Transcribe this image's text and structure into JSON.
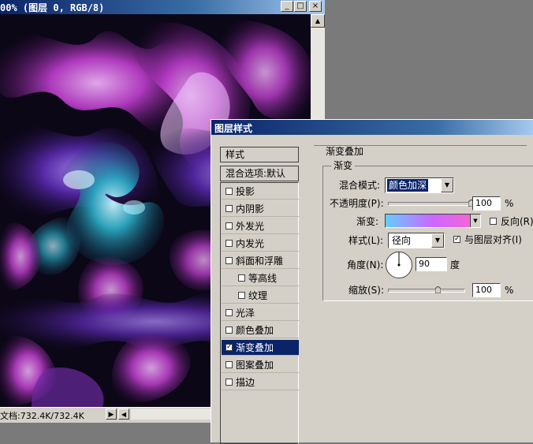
{
  "document": {
    "title": "00% (图层 0, RGB/8)",
    "buttons": {
      "minimize": "_",
      "maximize": "□",
      "close": "×"
    },
    "status_text": "文档:732.4K/732.4K"
  },
  "dialog": {
    "title": "图层样式",
    "list": {
      "header_styles": "样式",
      "header_blending": "混合选项:默认",
      "items": [
        {
          "label": "投影",
          "checked": false,
          "indent": false,
          "selected": false
        },
        {
          "label": "内阴影",
          "checked": false,
          "indent": false,
          "selected": false
        },
        {
          "label": "外发光",
          "checked": false,
          "indent": false,
          "selected": false
        },
        {
          "label": "内发光",
          "checked": false,
          "indent": false,
          "selected": false
        },
        {
          "label": "斜面和浮雕",
          "checked": false,
          "indent": false,
          "selected": false
        },
        {
          "label": "等高线",
          "checked": false,
          "indent": true,
          "selected": false
        },
        {
          "label": "纹理",
          "checked": false,
          "indent": true,
          "selected": false
        },
        {
          "label": "光泽",
          "checked": false,
          "indent": false,
          "selected": false
        },
        {
          "label": "颜色叠加",
          "checked": false,
          "indent": false,
          "selected": false
        },
        {
          "label": "渐变叠加",
          "checked": true,
          "indent": false,
          "selected": true
        },
        {
          "label": "图案叠加",
          "checked": false,
          "indent": false,
          "selected": false
        },
        {
          "label": "描边",
          "checked": false,
          "indent": false,
          "selected": false
        }
      ]
    },
    "panel": {
      "section_title": "渐变叠加",
      "group_title": "渐变",
      "blend_mode_label": "混合模式:",
      "blend_mode_value": "颜色加深",
      "opacity_label": "不透明度(P):",
      "opacity_value": "100",
      "opacity_unit": "%",
      "opacity_fraction": 1.0,
      "gradient_label": "渐变:",
      "gradient_colors": [
        "#66ccff",
        "#cc66ff",
        "#ff66cc"
      ],
      "reverse_label": "反向(R)",
      "reverse_checked": false,
      "style_label": "样式(L):",
      "style_value": "径向",
      "align_label": "与图层对齐(I)",
      "align_checked": true,
      "angle_label": "角度(N):",
      "angle_value": "90",
      "angle_unit": "度",
      "scale_label": "缩放(S):",
      "scale_value": "100",
      "scale_unit": "%",
      "scale_fraction": 0.667
    }
  },
  "colors": {
    "titlebar": "#0a246a",
    "selection": "#0a246a",
    "dialog_bg": "#d4d0c8",
    "workspace_bg": "#7a7a7a"
  }
}
